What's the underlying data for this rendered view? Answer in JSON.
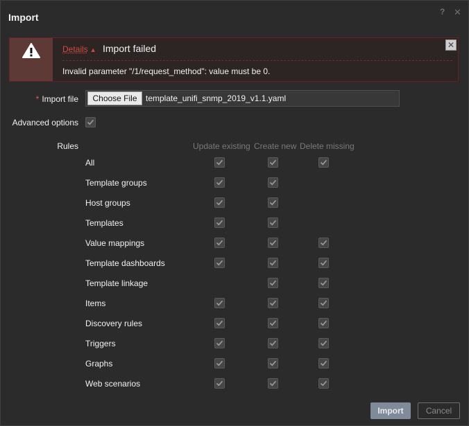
{
  "dialog": {
    "title": "Import",
    "help_icon": "?",
    "close_icon": "✕"
  },
  "message": {
    "icon": "warning-icon",
    "details_label": "Details",
    "details_arrow": "▲",
    "title": "Import failed",
    "body": "Invalid parameter \"/1/request_method\": value must be 0.",
    "close_icon": "✕"
  },
  "form": {
    "import_file_required_marker": "*",
    "import_file_label": "Import file",
    "choose_file_label": "Choose File",
    "file_name": "template_unifi_snmp_2019_v1.1.yaml",
    "advanced_options_label": "Advanced options",
    "advanced_options_checked": true,
    "rules_label": "Rules",
    "columns": [
      "Update existing",
      "Create new",
      "Delete missing"
    ],
    "rules": [
      {
        "label": "All",
        "update": true,
        "create": true,
        "delete": true
      },
      {
        "label": "Template groups",
        "update": true,
        "create": true,
        "delete": null
      },
      {
        "label": "Host groups",
        "update": true,
        "create": true,
        "delete": null
      },
      {
        "label": "Templates",
        "update": true,
        "create": true,
        "delete": null
      },
      {
        "label": "Value mappings",
        "update": true,
        "create": true,
        "delete": true
      },
      {
        "label": "Template dashboards",
        "update": true,
        "create": true,
        "delete": true
      },
      {
        "label": "Template linkage",
        "update": null,
        "create": true,
        "delete": true
      },
      {
        "label": "Items",
        "update": true,
        "create": true,
        "delete": true
      },
      {
        "label": "Discovery rules",
        "update": true,
        "create": true,
        "delete": true
      },
      {
        "label": "Triggers",
        "update": true,
        "create": true,
        "delete": true
      },
      {
        "label": "Graphs",
        "update": true,
        "create": true,
        "delete": true
      },
      {
        "label": "Web scenarios",
        "update": true,
        "create": true,
        "delete": true
      }
    ]
  },
  "footer": {
    "import_label": "Import",
    "cancel_label": "Cancel"
  },
  "colors": {
    "background": "#2b2b2b",
    "error_border": "#6b1f1f",
    "error_text": "#d14a3c",
    "primary_button": "#7f8b99"
  }
}
